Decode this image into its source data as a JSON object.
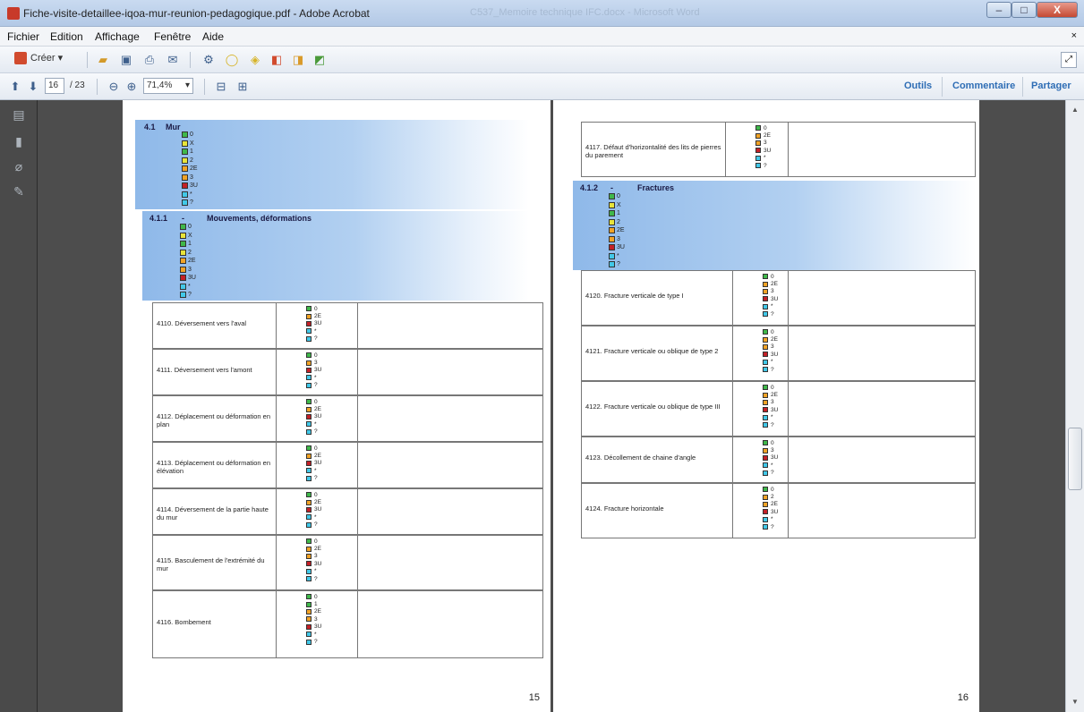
{
  "window": {
    "title": "Fiche-visite-detaillee-iqoa-mur-reunion-pedagogique.pdf - Adobe Acrobat",
    "background_title": "C537_Memoire technique IFC.docx - Microsoft Word",
    "minimize": "–",
    "maximize": "□",
    "close": "X"
  },
  "menu": {
    "items": [
      "Fichier",
      "Edition",
      "Affichage",
      "Fenêtre",
      "Aide"
    ],
    "close": "×"
  },
  "toolbar": {
    "create_label": "Créer",
    "create_caret": "▾",
    "zoom": "71,4%",
    "page_current": "16",
    "page_total": "/ 23",
    "links": [
      "Outils",
      "Commentaire",
      "Partager"
    ]
  },
  "colors": {
    "green": "#3fb84a",
    "yellow": "#e8e43a",
    "orange": "#f1a326",
    "red": "#c42027",
    "cyan": "#41c8e8",
    "empty": "#ffffff"
  },
  "left_page": {
    "page_number": "15",
    "section": {
      "number": "4.1",
      "title": "Mur",
      "legend": [
        {
          "c": "green",
          "t": "0"
        },
        {
          "c": "yellow",
          "t": "X"
        },
        {
          "c": "green",
          "t": "1"
        },
        {
          "c": "yellow",
          "t": "2"
        },
        {
          "c": "orange",
          "t": "2E"
        },
        {
          "c": "orange",
          "t": "3"
        },
        {
          "c": "red",
          "t": "3U"
        },
        {
          "c": "cyan",
          "t": "*"
        },
        {
          "c": "cyan",
          "t": "?"
        }
      ]
    },
    "subsection": {
      "number": "4.1.1",
      "dash": "-",
      "title": "Mouvements, déformations",
      "legend": [
        {
          "c": "green",
          "t": "0"
        },
        {
          "c": "yellow",
          "t": "X"
        },
        {
          "c": "green",
          "t": "1"
        },
        {
          "c": "yellow",
          "t": "2"
        },
        {
          "c": "orange",
          "t": "2E"
        },
        {
          "c": "orange",
          "t": "3"
        },
        {
          "c": "red",
          "t": "3U"
        },
        {
          "c": "cyan",
          "t": "*"
        },
        {
          "c": "cyan",
          "t": "?"
        }
      ]
    },
    "rows": [
      {
        "label": "4110. Déversement vers l'aval",
        "legend": [
          {
            "c": "green",
            "t": "0"
          },
          {
            "c": "orange",
            "t": "2E"
          },
          {
            "c": "red",
            "t": "3U"
          },
          {
            "c": "cyan",
            "t": "*"
          },
          {
            "c": "cyan",
            "t": "?"
          }
        ]
      },
      {
        "label": "4111. Déversement vers l'amont",
        "legend": [
          {
            "c": "green",
            "t": "0"
          },
          {
            "c": "orange",
            "t": "3"
          },
          {
            "c": "red",
            "t": "3U"
          },
          {
            "c": "cyan",
            "t": "*"
          },
          {
            "c": "cyan",
            "t": "?"
          }
        ]
      },
      {
        "label": "4112. Déplacement ou déformation en plan",
        "legend": [
          {
            "c": "green",
            "t": "0"
          },
          {
            "c": "orange",
            "t": "2E"
          },
          {
            "c": "red",
            "t": "3U"
          },
          {
            "c": "cyan",
            "t": "*"
          },
          {
            "c": "cyan",
            "t": "?"
          }
        ]
      },
      {
        "label": "4113. Déplacement ou déformation en élévation",
        "legend": [
          {
            "c": "green",
            "t": "0"
          },
          {
            "c": "orange",
            "t": "2E"
          },
          {
            "c": "red",
            "t": "3U"
          },
          {
            "c": "cyan",
            "t": "*"
          },
          {
            "c": "cyan",
            "t": "?"
          }
        ]
      },
      {
        "label": "4114. Déversement de la partie haute du mur",
        "legend": [
          {
            "c": "green",
            "t": "0"
          },
          {
            "c": "orange",
            "t": "2E"
          },
          {
            "c": "red",
            "t": "3U"
          },
          {
            "c": "cyan",
            "t": "*"
          },
          {
            "c": "cyan",
            "t": "?"
          }
        ]
      },
      {
        "label": "4115. Basculement de l'extrémité du mur",
        "legend": [
          {
            "c": "green",
            "t": "0"
          },
          {
            "c": "orange",
            "t": "2E"
          },
          {
            "c": "orange",
            "t": "3"
          },
          {
            "c": "red",
            "t": "3U"
          },
          {
            "c": "cyan",
            "t": "*"
          },
          {
            "c": "cyan",
            "t": "?"
          }
        ]
      },
      {
        "label": "4116. Bombement",
        "legend": [
          {
            "c": "green",
            "t": "0"
          },
          {
            "c": "green",
            "t": "1"
          },
          {
            "c": "orange",
            "t": "2E"
          },
          {
            "c": "orange",
            "t": "3"
          },
          {
            "c": "red",
            "t": "3U"
          },
          {
            "c": "cyan",
            "t": "*"
          },
          {
            "c": "cyan",
            "t": "?"
          }
        ]
      }
    ]
  },
  "right_page": {
    "page_number": "16",
    "top_row": {
      "label": "4117. Défaut d'horizontalité des lits de pierres du parement",
      "legend": [
        {
          "c": "green",
          "t": "0"
        },
        {
          "c": "orange",
          "t": "2E"
        },
        {
          "c": "orange",
          "t": "3"
        },
        {
          "c": "red",
          "t": "3U"
        },
        {
          "c": "cyan",
          "t": "*"
        },
        {
          "c": "cyan",
          "t": "?"
        }
      ]
    },
    "subsection": {
      "number": "4.1.2",
      "dash": "-",
      "title": "Fractures",
      "legend": [
        {
          "c": "green",
          "t": "0"
        },
        {
          "c": "yellow",
          "t": "X"
        },
        {
          "c": "green",
          "t": "1"
        },
        {
          "c": "yellow",
          "t": "2"
        },
        {
          "c": "orange",
          "t": "2E"
        },
        {
          "c": "orange",
          "t": "3"
        },
        {
          "c": "red",
          "t": "3U"
        },
        {
          "c": "cyan",
          "t": "*"
        },
        {
          "c": "cyan",
          "t": "?"
        }
      ]
    },
    "rows": [
      {
        "label": "4120. Fracture verticale de type I",
        "legend": [
          {
            "c": "green",
            "t": "0"
          },
          {
            "c": "orange",
            "t": "2E"
          },
          {
            "c": "orange",
            "t": "3"
          },
          {
            "c": "red",
            "t": "3U"
          },
          {
            "c": "cyan",
            "t": "*"
          },
          {
            "c": "cyan",
            "t": "?"
          }
        ]
      },
      {
        "label": "4121. Fracture verticale ou oblique de type 2",
        "legend": [
          {
            "c": "green",
            "t": "0"
          },
          {
            "c": "orange",
            "t": "2E"
          },
          {
            "c": "orange",
            "t": "3"
          },
          {
            "c": "red",
            "t": "3U"
          },
          {
            "c": "cyan",
            "t": "*"
          },
          {
            "c": "cyan",
            "t": "?"
          }
        ]
      },
      {
        "label": "4122. Fracture verticale ou oblique de type III",
        "legend": [
          {
            "c": "green",
            "t": "0"
          },
          {
            "c": "orange",
            "t": "2E"
          },
          {
            "c": "orange",
            "t": "3"
          },
          {
            "c": "red",
            "t": "3U"
          },
          {
            "c": "cyan",
            "t": "*"
          },
          {
            "c": "cyan",
            "t": "?"
          }
        ]
      },
      {
        "label": "4123. Décollement de chaine d'angle",
        "legend": [
          {
            "c": "green",
            "t": "0"
          },
          {
            "c": "orange",
            "t": "3"
          },
          {
            "c": "red",
            "t": "3U"
          },
          {
            "c": "cyan",
            "t": "*"
          },
          {
            "c": "cyan",
            "t": "?"
          }
        ]
      },
      {
        "label": "4124. Fracture horizontale",
        "legend": [
          {
            "c": "green",
            "t": "0"
          },
          {
            "c": "orange",
            "t": "2"
          },
          {
            "c": "orange",
            "t": "2E"
          },
          {
            "c": "red",
            "t": "3U"
          },
          {
            "c": "cyan",
            "t": "*"
          },
          {
            "c": "cyan",
            "t": "?"
          }
        ]
      }
    ]
  }
}
